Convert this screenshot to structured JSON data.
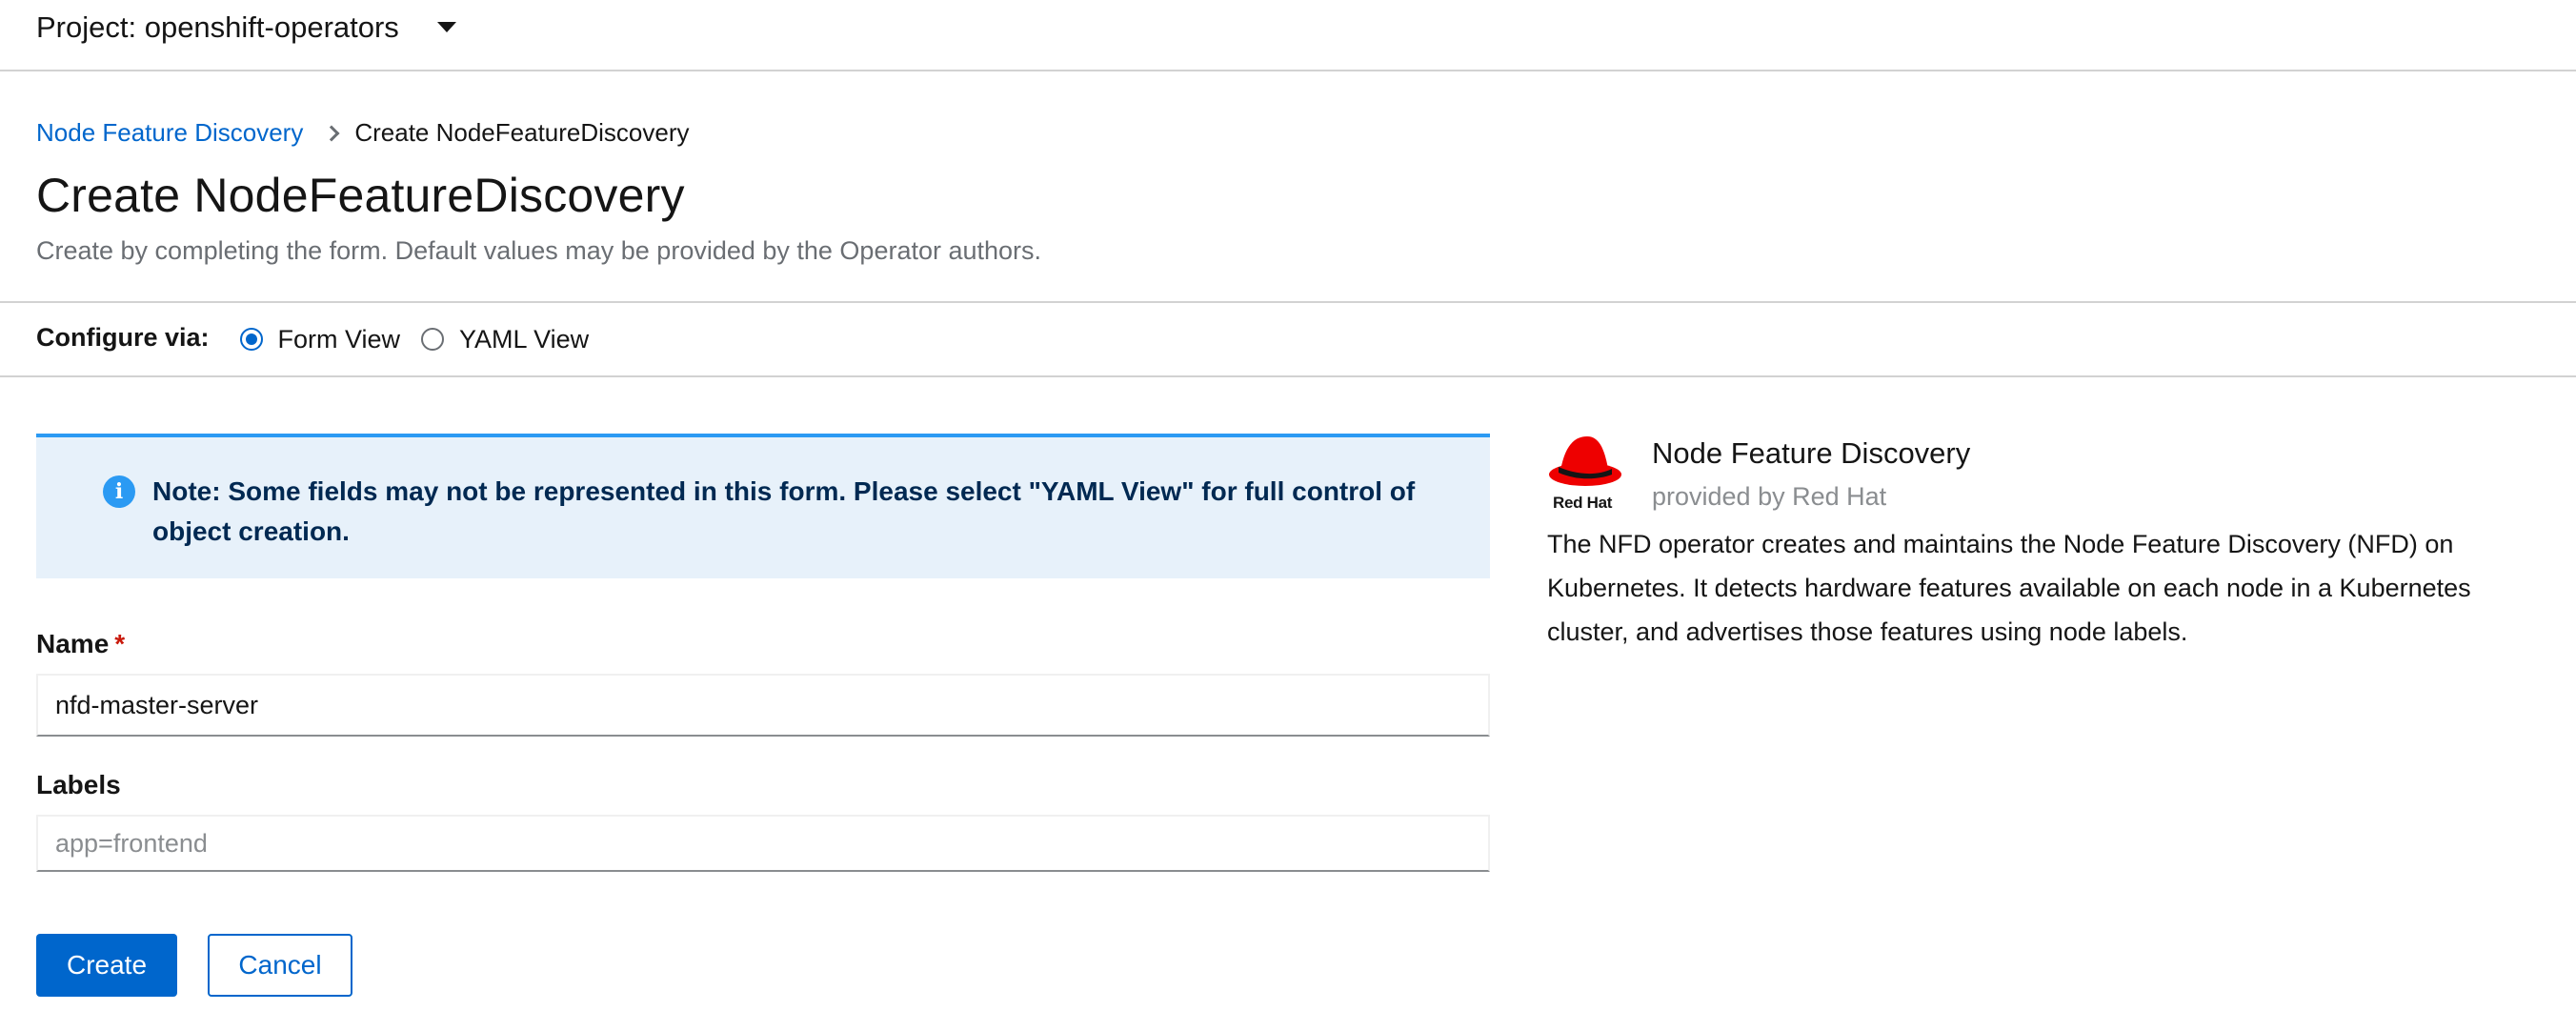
{
  "project_bar": {
    "label": "Project: openshift-operators"
  },
  "breadcrumb": {
    "parent": "Node Feature Discovery",
    "current": "Create NodeFeatureDiscovery"
  },
  "page": {
    "title": "Create NodeFeatureDiscovery",
    "subtitle": "Create by completing the form. Default values may be provided by the Operator authors."
  },
  "configure": {
    "label": "Configure via:",
    "options": [
      {
        "label": "Form View",
        "selected": true
      },
      {
        "label": "YAML View",
        "selected": false
      }
    ]
  },
  "alert": {
    "text": "Note: Some fields may not be represented in this form. Please select \"YAML View\" for full control of object creation."
  },
  "form": {
    "name": {
      "label": "Name",
      "required_mark": "*",
      "value": "nfd-master-server"
    },
    "labels": {
      "label": "Labels",
      "value": "",
      "placeholder": "app=frontend"
    }
  },
  "actions": {
    "create": "Create",
    "cancel": "Cancel"
  },
  "operator": {
    "logo_text": "Red Hat",
    "name": "Node Feature Discovery",
    "provider": "provided by Red Hat",
    "description": "The NFD operator creates and maintains the Node Feature Discovery (NFD) on Kubernetes. It detects hardware features available on each node in a Kubernetes cluster, and advertises those features using node labels."
  },
  "colors": {
    "link": "#0066cc",
    "primary": "#0066cc",
    "alert_bg": "#e7f1fa",
    "alert_border": "#2b9af3",
    "required": "#c9190b",
    "redhat_red": "#ee0000"
  }
}
